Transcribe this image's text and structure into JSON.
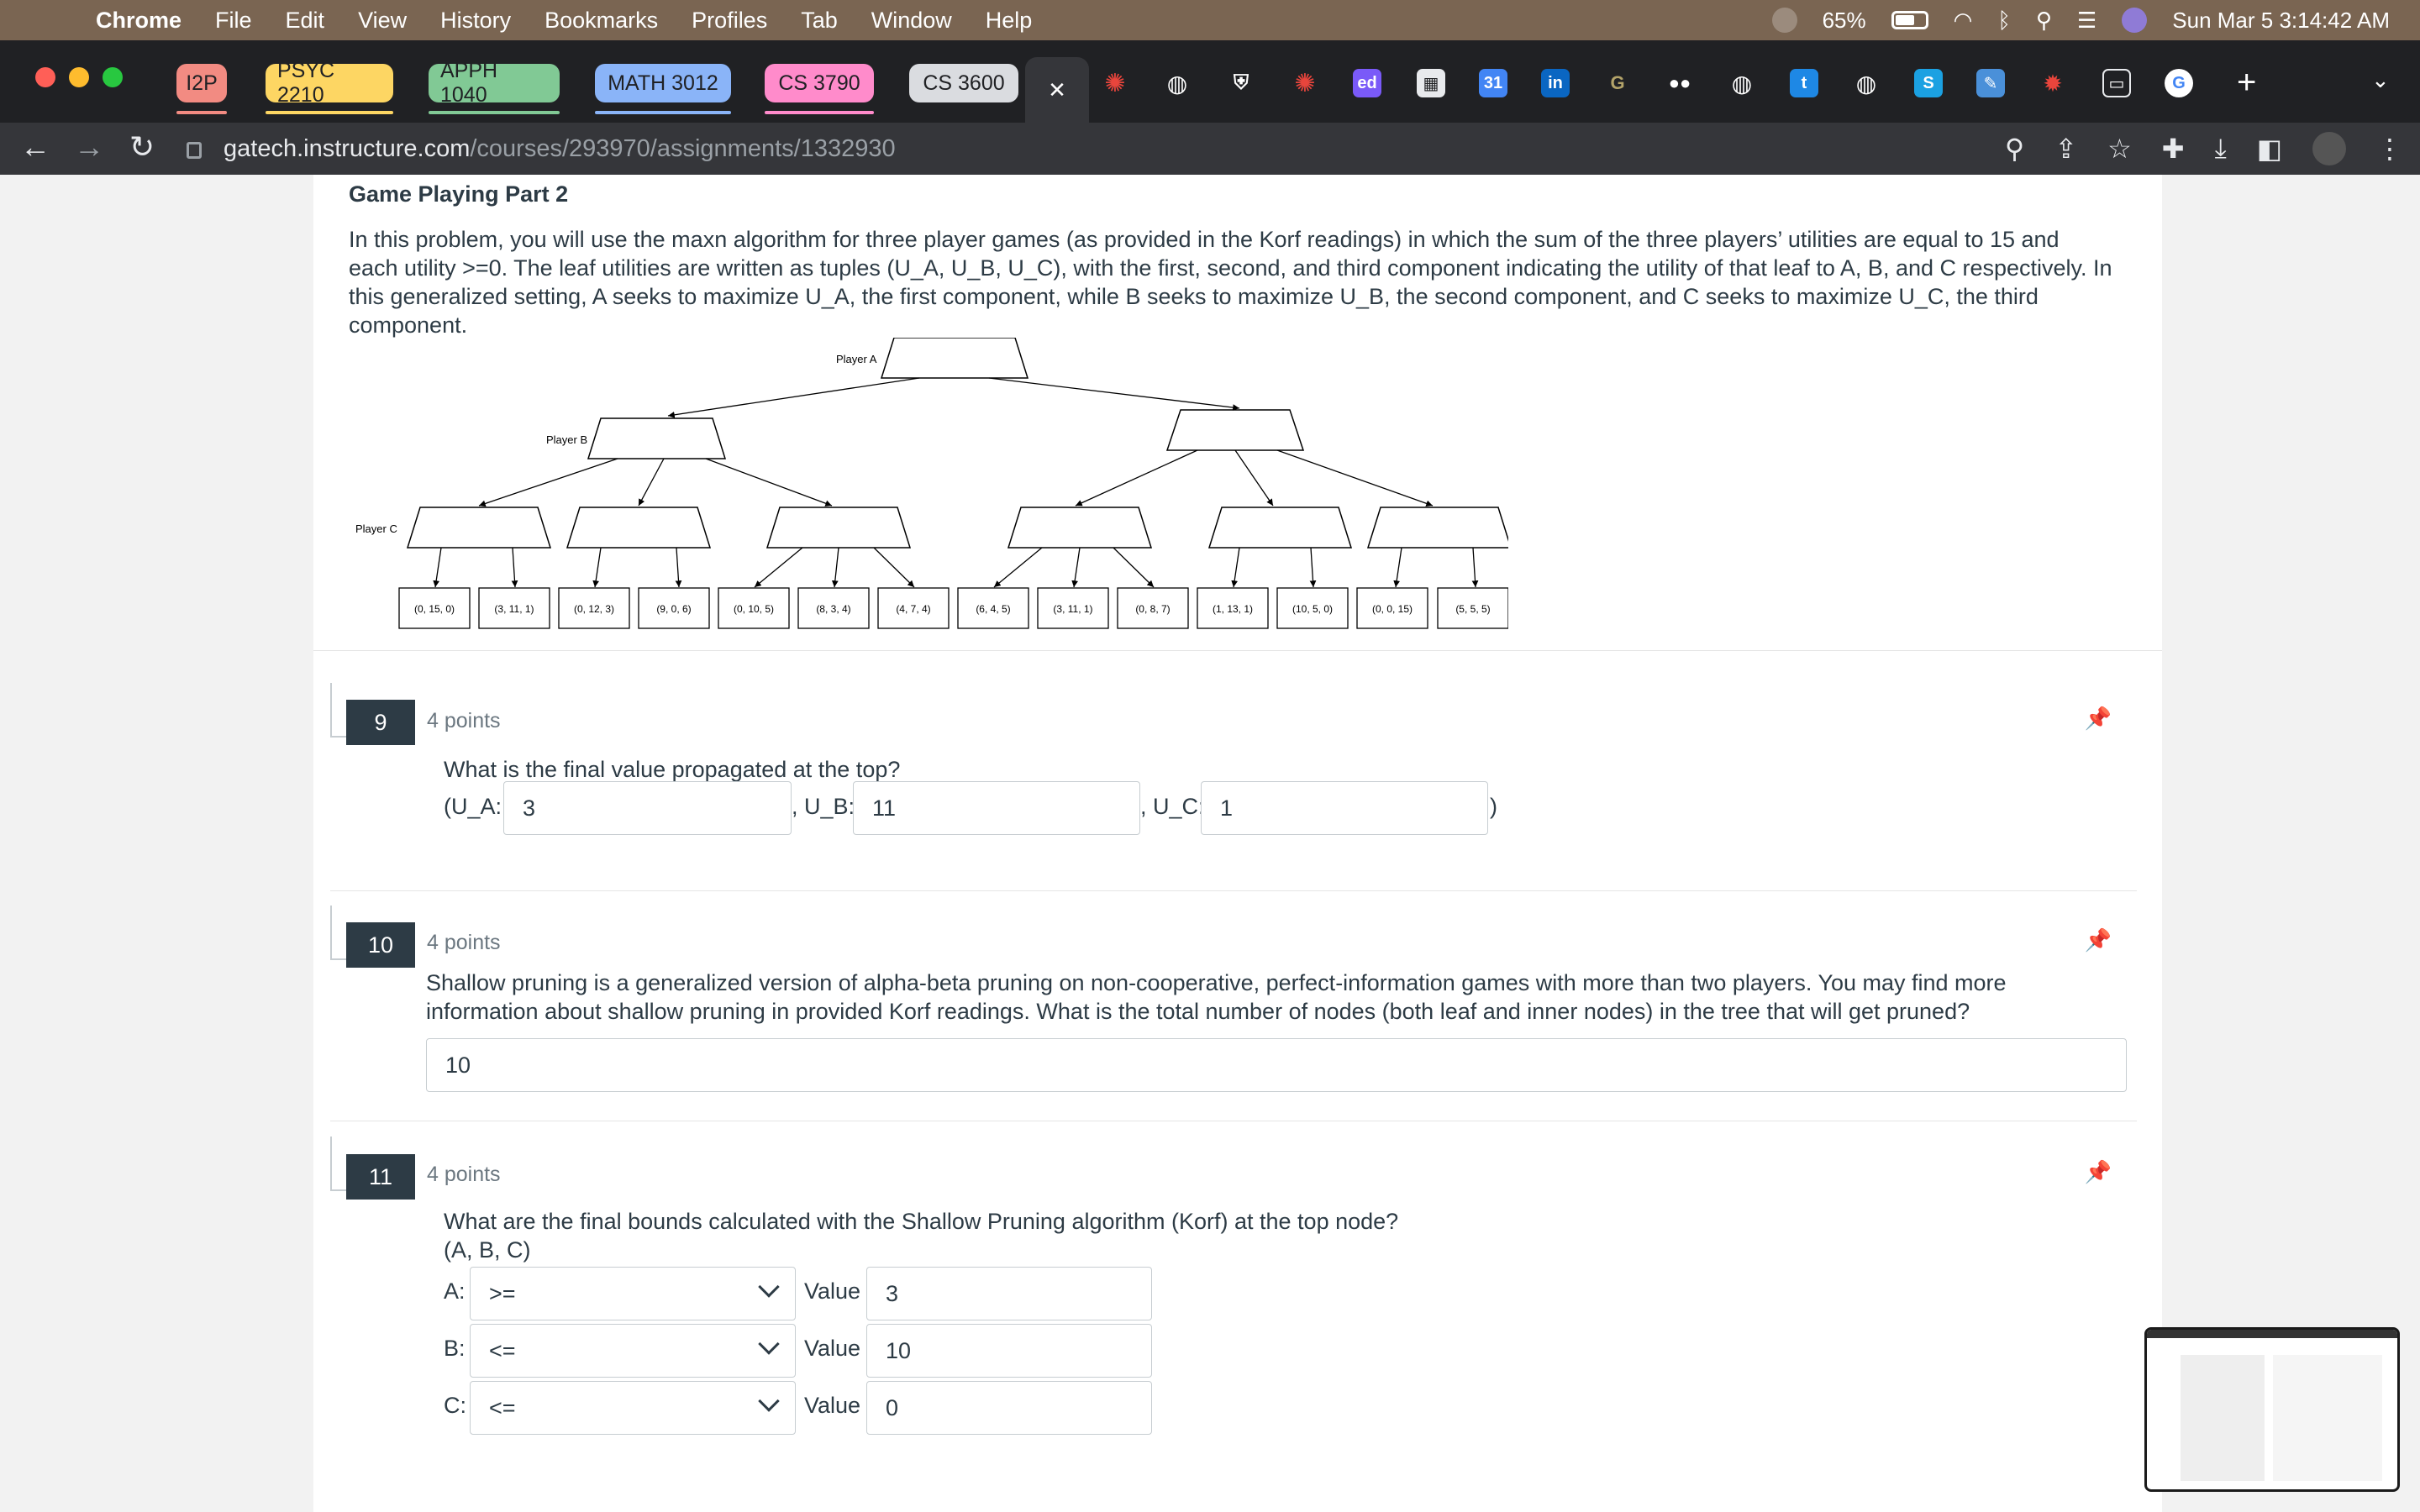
{
  "menubar": {
    "app": "Chrome",
    "items": [
      "File",
      "Edit",
      "View",
      "History",
      "Bookmarks",
      "Profiles",
      "Tab",
      "Window",
      "Help"
    ],
    "battery": "65%",
    "datetime": "Sun Mar 5  3:14:42 AM"
  },
  "tabs": {
    "groups": [
      {
        "label": "I2P",
        "color": "#f28b82"
      },
      {
        "label": "PSYC 2210",
        "color": "#fdd663"
      },
      {
        "label": "APPH 1040",
        "color": "#81c995"
      },
      {
        "label": "MATH 3012",
        "color": "#8ab4f8"
      },
      {
        "label": "CS 3790",
        "color": "#ff8bcb"
      },
      {
        "label": "CS 3600",
        "color": "#dadce0"
      }
    ],
    "active_close": "✕",
    "favicons": [
      "ed",
      "in",
      "31",
      "t",
      "G"
    ]
  },
  "address": {
    "host": "gatech.instructure.com",
    "path": "/courses/293970/assignments/1332930"
  },
  "intro": {
    "title": "Game Playing Part 2",
    "text": "In this problem, you will use the maxn algorithm for three player games (as provided in the Korf readings) in which the sum of the three players’ utilities are  equal to 15 and each utility >=0. The leaf utilities are written as tuples (U_A, U_B, U_C), with the first, second, and third component indicating the utility of that leaf to A, B, and C respectively. In this generalized setting, A seeks to maximize U_A, the first component, while B seeks to maximize U_B, the second component, and C seeks to maximize U_C, the third component."
  },
  "tree": {
    "player_a": "Player A",
    "player_b": "Player B",
    "player_c": "Player C",
    "leaves": [
      "(0, 15, 0)",
      "(3, 11, 1)",
      "(0, 12, 3)",
      "(9, 0, 6)",
      "(0, 10, 5)",
      "(8, 3, 4)",
      "(4, 7, 4)",
      "(6, 4, 5)",
      "(3, 11, 1)",
      "(0, 8, 7)",
      "(1, 13, 1)",
      "(10, 5, 0)",
      "(0, 0, 15)",
      "(5, 5, 5)"
    ]
  },
  "q9": {
    "num": "9",
    "points": "4 points",
    "text": "What is the final value propagated at the top?",
    "ua_label": "(U_A:",
    "ua": "3",
    "ub_label": ", U_B:",
    "ub": "11",
    "uc_label": ", U_C:",
    "uc": "1",
    "close": ")"
  },
  "q10": {
    "num": "10",
    "points": "4 points",
    "text": "Shallow pruning is a generalized version of alpha-beta pruning on non-cooperative, perfect-information games with more than two players. You may find more information about shallow pruning in provided Korf readings. What is the total number of nodes (both leaf and inner nodes) in the tree that will get pruned?",
    "answer": "10"
  },
  "q11": {
    "num": "11",
    "points": "4 points",
    "text": "What are the final bounds calculated with the Shallow Pruning algorithm (Korf) at the top node?",
    "sub": "(A, B, C)",
    "value_label": "Value",
    "rows": [
      {
        "label": "A:",
        "op": ">=",
        "value": "3"
      },
      {
        "label": "B:",
        "op": "<=",
        "value": "10"
      },
      {
        "label": "C:",
        "op": "<=",
        "value": "0"
      }
    ]
  }
}
